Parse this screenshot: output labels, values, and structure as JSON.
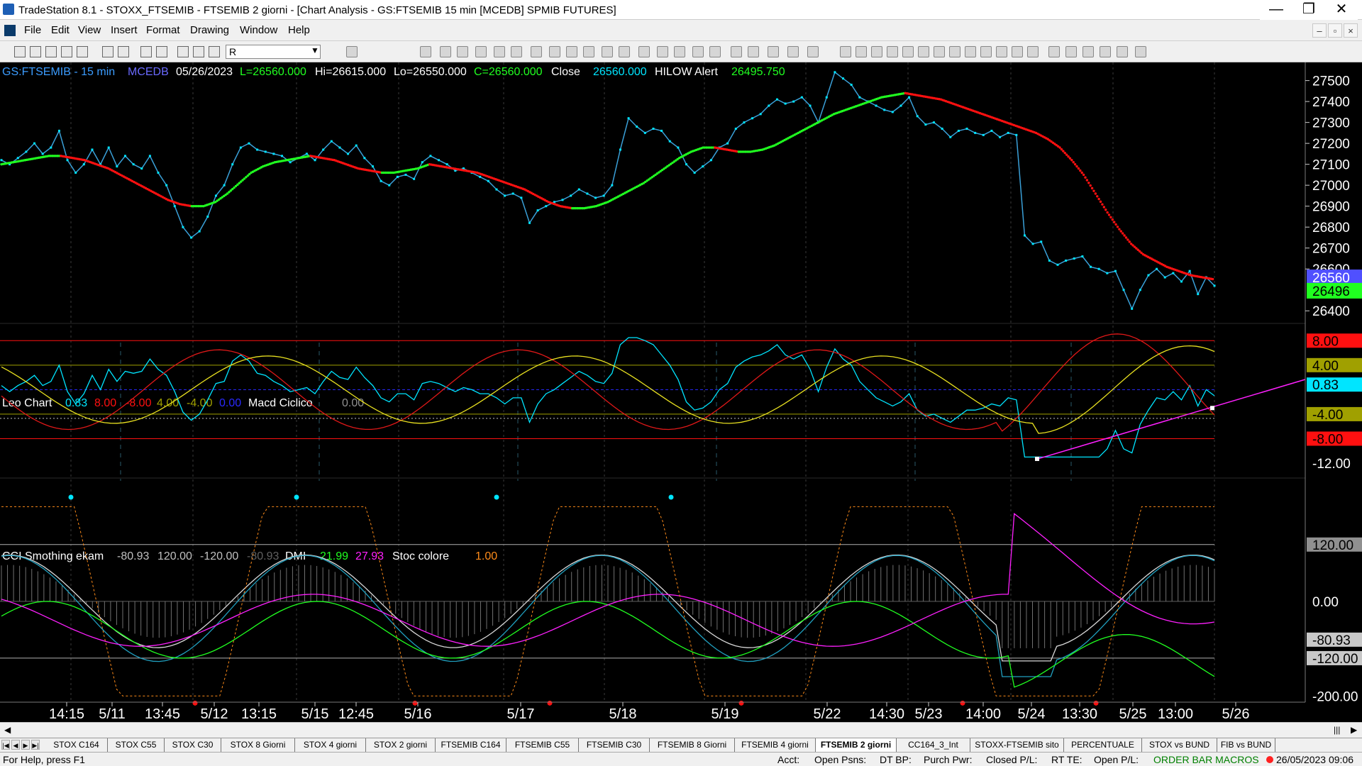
{
  "window": {
    "title": "TradeStation 8.1 - STOXX_FTSEMIB - FTSEMIB  2 giorni - [Chart Analysis - GS:FTSEMIB  15 min  [MCEDB] SPMIB FUTURES]",
    "controls": {
      "minimize": "—",
      "restore": "❐",
      "close": "✕"
    }
  },
  "menu": {
    "items": [
      "File",
      "Edit",
      "View",
      "Insert",
      "Format",
      "Drawing",
      "Window",
      "Help"
    ]
  },
  "mdi": {
    "minimize": "–",
    "restore": "▫",
    "close": "×"
  },
  "toolbar": {
    "symbol_value": "R"
  },
  "colors": {
    "cyan": "#00e5ff",
    "red": "#ff1010",
    "green": "#20ff20",
    "yellow": "#ffff30",
    "magenta": "#ff20ff",
    "orange": "#ff8c1a",
    "grey": "#909090",
    "white": "#e8e8e8",
    "olive": "#a0a000",
    "blue": "#2a2aff"
  },
  "header": {
    "symbol": "GS:FTSEMIB - 15 min",
    "feed": "MCEDB",
    "date": "05/26/2023",
    "last": "L=26560.000",
    "high": "Hi=26615.000",
    "low": "Lo=26550.000",
    "close_eq": "C=26560.000",
    "close_label": "Close",
    "close_value": "26560.000",
    "hilow_label": "HILOW Alert",
    "hilow_value": "26495.750"
  },
  "panel2": {
    "label": "Leo Chart",
    "v1": "0.83",
    "v2": "8.00",
    "v3": "-8.00",
    "v4": "4.00",
    "v5": "-4.00",
    "v6": "0.00",
    "label2": "Macd Ciclico",
    "v7": "0.00"
  },
  "panel3": {
    "label": "CCI Smothing ekam",
    "v1": "-80.93",
    "v2": "120.00",
    "v3": "-120.00",
    "v4": "-80.93",
    "dmi_label": "DMI",
    "dmi_v1": "21.99",
    "dmi_v2": "27.93",
    "stoc_label": "Stoc colore",
    "stoc_v": "1.00"
  },
  "chart_data": {
    "type": "line",
    "price_axis": [
      "27500",
      "27400",
      "27300",
      "27200",
      "27100",
      "27000",
      "26900",
      "26800",
      "26700",
      "26600",
      "26400"
    ],
    "price_ylim": [
      26350,
      27580
    ],
    "price_close": [
      27120,
      27100,
      27130,
      27160,
      27200,
      27150,
      27180,
      27260,
      27120,
      27060,
      27100,
      27170,
      27100,
      27180,
      27090,
      27140,
      27100,
      27080,
      27140,
      27060,
      27000,
      26900,
      26800,
      26750,
      26780,
      26850,
      26950,
      27000,
      27100,
      27180,
      27200,
      27170,
      27160,
      27150,
      27140,
      27110,
      27130,
      27150,
      27120,
      27170,
      27210,
      27180,
      27150,
      27190,
      27130,
      27090,
      27020,
      27000,
      27040,
      27050,
      27030,
      27110,
      27140,
      27120,
      27100,
      27070,
      27080,
      27060,
      27040,
      27020,
      26980,
      26950,
      26960,
      26940,
      26820,
      26880,
      26900,
      26920,
      26930,
      26950,
      26980,
      26960,
      26940,
      26950,
      27000,
      27170,
      27320,
      27280,
      27250,
      27270,
      27260,
      27210,
      27180,
      27100,
      27060,
      27090,
      27120,
      27180,
      27200,
      27270,
      27300,
      27320,
      27340,
      27380,
      27410,
      27390,
      27400,
      27420,
      27380,
      27300,
      27420,
      27540,
      27510,
      27480,
      27420,
      27400,
      27380,
      27360,
      27350,
      27380,
      27420,
      27330,
      27290,
      27300,
      27270,
      27230,
      27260,
      27270,
      27250,
      27240,
      27260,
      27230,
      27250,
      27240,
      26760,
      26720,
      26730,
      26640,
      26620,
      26640,
      26650,
      26660,
      26610,
      26600,
      26580,
      26590,
      26500,
      26410,
      26500,
      26570,
      26600,
      26560,
      26580,
      26540,
      26590,
      26480,
      26560,
      26520
    ],
    "price_hilow": [
      27100,
      27110,
      27120,
      27130,
      27140,
      27140,
      27130,
      27120,
      27100,
      27080,
      27050,
      27020,
      26990,
      26960,
      26930,
      26910,
      26900,
      26900,
      26920,
      26960,
      27010,
      27060,
      27090,
      27110,
      27120,
      27130,
      27140,
      27130,
      27120,
      27100,
      27080,
      27070,
      27060,
      27060,
      27070,
      27080,
      27100,
      27090,
      27080,
      27070,
      27060,
      27040,
      27020,
      27000,
      26980,
      26950,
      26920,
      26900,
      26890,
      26890,
      26900,
      26920,
      26950,
      26980,
      27010,
      27050,
      27090,
      27130,
      27160,
      27180,
      27180,
      27170,
      27160,
      27160,
      27170,
      27190,
      27220,
      27250,
      27280,
      27310,
      27340,
      27360,
      27380,
      27400,
      27420,
      27430,
      27440,
      27430,
      27420,
      27410,
      27390,
      27370,
      27350,
      27330,
      27310,
      27290,
      27270,
      27250,
      27220,
      27180,
      27120,
      27050,
      26960,
      26870,
      26790,
      26720,
      26670,
      26640,
      26610,
      26590,
      26570,
      26560,
      26550
    ],
    "osc_axis": [
      "8.00",
      "4.00",
      "0.83",
      "-4.00",
      "-8.00",
      "-12.00"
    ],
    "cci_axis": [
      "120.00",
      "0.00",
      "-80.93",
      "-120.00",
      "-200.00"
    ],
    "x_labels": [
      "14:15",
      "5/11",
      "13:45",
      "5/12",
      "13:15",
      "5/15",
      "12:45",
      "5/16",
      "5/17",
      "5/18",
      "5/19",
      "5/22",
      "14:30",
      "5/23",
      "14:00",
      "5/24",
      "13:30",
      "5/25",
      "13:00",
      "5/26"
    ],
    "price_tags": [
      "26560",
      "26496"
    ],
    "osc_tags": [
      "8.00",
      "4.00",
      "0.83",
      "-4.00",
      "-8.00"
    ],
    "cci_tags": [
      "120.00",
      "0.00",
      "-80.93",
      "-120.00"
    ]
  },
  "tabs": {
    "nav": [
      "|◀",
      "◀",
      "▶",
      "▶|"
    ],
    "items": [
      "STOX C164",
      "STOX C55",
      "STOX  C30",
      "STOX  8 Giorni",
      "STOX 4 giorni",
      "STOX  2 giorni",
      "FTSEMIB C164",
      "FTSEMIB C55",
      "FTSEMIB C30",
      "FTSEMIB  8 Giorni",
      "FTSEMIB  4 giorni",
      "FTSEMIB  2 giorni",
      "CC164_3_Int",
      "STOXX-FTSEMIB sito",
      "PERCENTUALE",
      "STOX vs BUND",
      "FIB vs BUND"
    ],
    "active_index": 11
  },
  "status": {
    "help": "For Help, press F1",
    "acct": "Acct:",
    "open_psns": "Open Psns:",
    "dt_bp": "DT BP:",
    "purch_pwr": "Purch Pwr:",
    "closed_pl": "Closed P/L:",
    "rt_te": "RT TE:",
    "open_pl": "Open P/L:",
    "macros": "ORDER BAR  MACROS",
    "datetime": "26/05/2023 09:06"
  }
}
